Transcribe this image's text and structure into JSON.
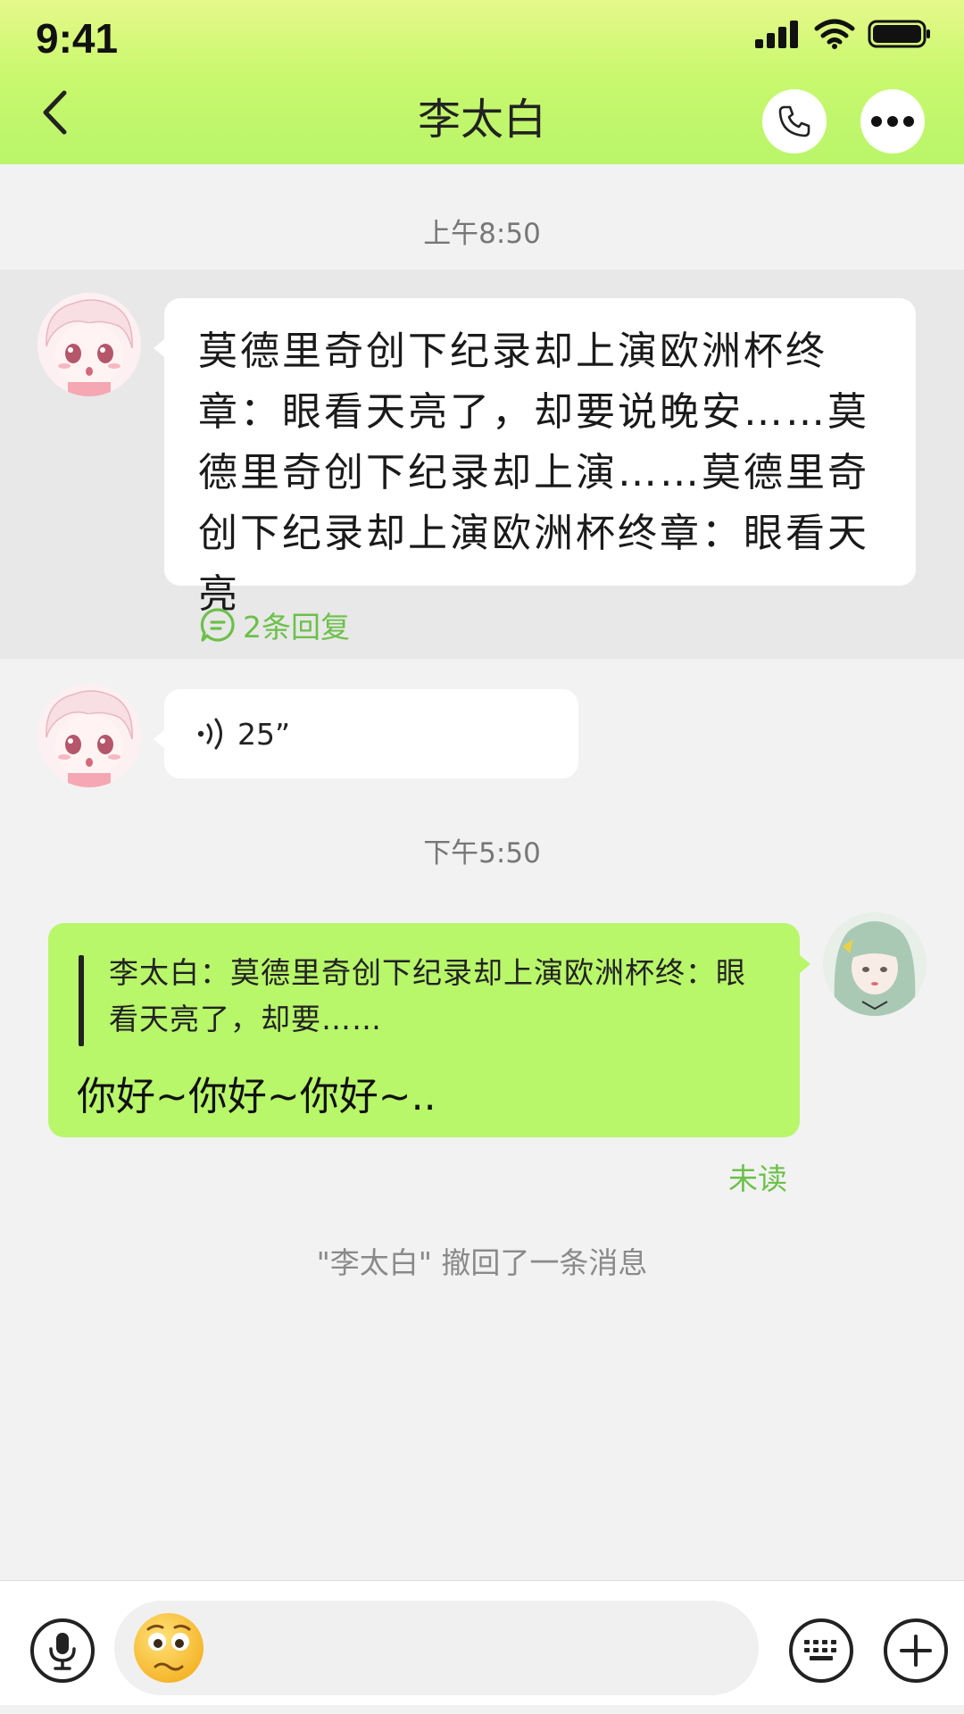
{
  "status_bar": {
    "time": "9:41"
  },
  "header": {
    "title": "李太白"
  },
  "messages": {
    "time_1": "上午8:50",
    "long_text": "莫德里奇创下纪录却上演欧洲杯终章：眼看天亮了，却要说晚安……莫德里奇创下纪录却上演……莫德里奇创下纪录却上演欧洲杯终章：眼看天亮",
    "replies": "2条回复",
    "voice_duration": "25”",
    "time_2": "下午5:50",
    "quote": "李太白：莫德里奇创下纪录却上演欧洲杯终：眼看天亮了，却要……",
    "reply_message": "你好~你好~你好~..",
    "unread": "未读",
    "recalled": "\"李太白\" 撤回了一条消息"
  },
  "input": {
    "placeholder": ""
  },
  "colors": {
    "accent_green": "#b8f66a",
    "link_green": "#6cc04a"
  }
}
